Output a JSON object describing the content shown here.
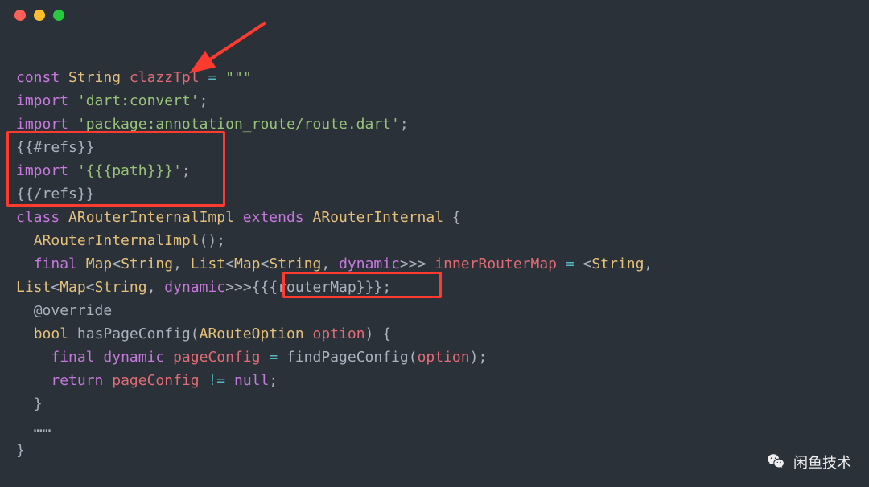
{
  "window_controls": {
    "close": "#ff5f56",
    "minimize": "#ffbd2e",
    "maximize": "#27c93f"
  },
  "code": {
    "line1": {
      "kw1": "const",
      "type1": "String",
      "var1": "clazzTpl",
      "op": "=",
      "str": "\"\"\""
    },
    "line2": {
      "kw": "import",
      "str": "'dart:convert'",
      "semi": ";"
    },
    "line3": {
      "kw": "import",
      "str": "'package:annotation_route/route.dart'",
      "semi": ";"
    },
    "line4": {
      "text": "{{#refs}}"
    },
    "line5": {
      "kw": "import",
      "str": "'{{{path}}}'",
      "semi": ";"
    },
    "line6": {
      "text": "{{/refs}}"
    },
    "line7": {
      "kw": "class",
      "type1": "ARouterInternalImpl",
      "kw2": "extends",
      "type2": "ARouterInternal",
      "brace": "{"
    },
    "line8": {
      "call": "ARouterInternalImpl",
      "paren": "();"
    },
    "line9": {
      "kw": "final",
      "type1": "Map",
      "lt1": "<",
      "type2": "String",
      "c1": ",",
      "type3": "List",
      "lt2": "<",
      "type4": "Map",
      "lt3": "<",
      "type5": "String",
      "c2": ",",
      "type6": "dynamic",
      "gt": ">>>",
      "var": "innerRouterMap",
      "op": "=",
      "lt4": "<",
      "type7": "String",
      "c3": ","
    },
    "line10": {
      "type1": "List",
      "lt1": "<",
      "type2": "Map",
      "lt2": "<",
      "type3": "String",
      "c1": ",",
      "type4": "dynamic",
      "gt": ">>>",
      "tmpl": "{{{routerMap}}}",
      "semi": ";"
    },
    "line11": {
      "annot": "@override"
    },
    "line12": {
      "type1": "bool",
      "fn": "hasPageConfig",
      "lp": "(",
      "type2": "ARouteOption",
      "param": "option",
      "rp": ")",
      "brace": "{"
    },
    "line13": {
      "kw": "final",
      "type": "dynamic",
      "var": "pageConfig",
      "op": "=",
      "fn": "findPageConfig",
      "lp": "(",
      "arg": "option",
      "rp": ")",
      "semi": ";"
    },
    "line14": {
      "kw": "return",
      "var": "pageConfig",
      "op": "!=",
      "null": "null",
      "semi": ";"
    },
    "line15": {
      "brace": "}"
    },
    "line16": {
      "ellipsis": "……"
    },
    "line17": {
      "brace": "}"
    }
  },
  "watermark": {
    "text": "闲鱼技术"
  }
}
